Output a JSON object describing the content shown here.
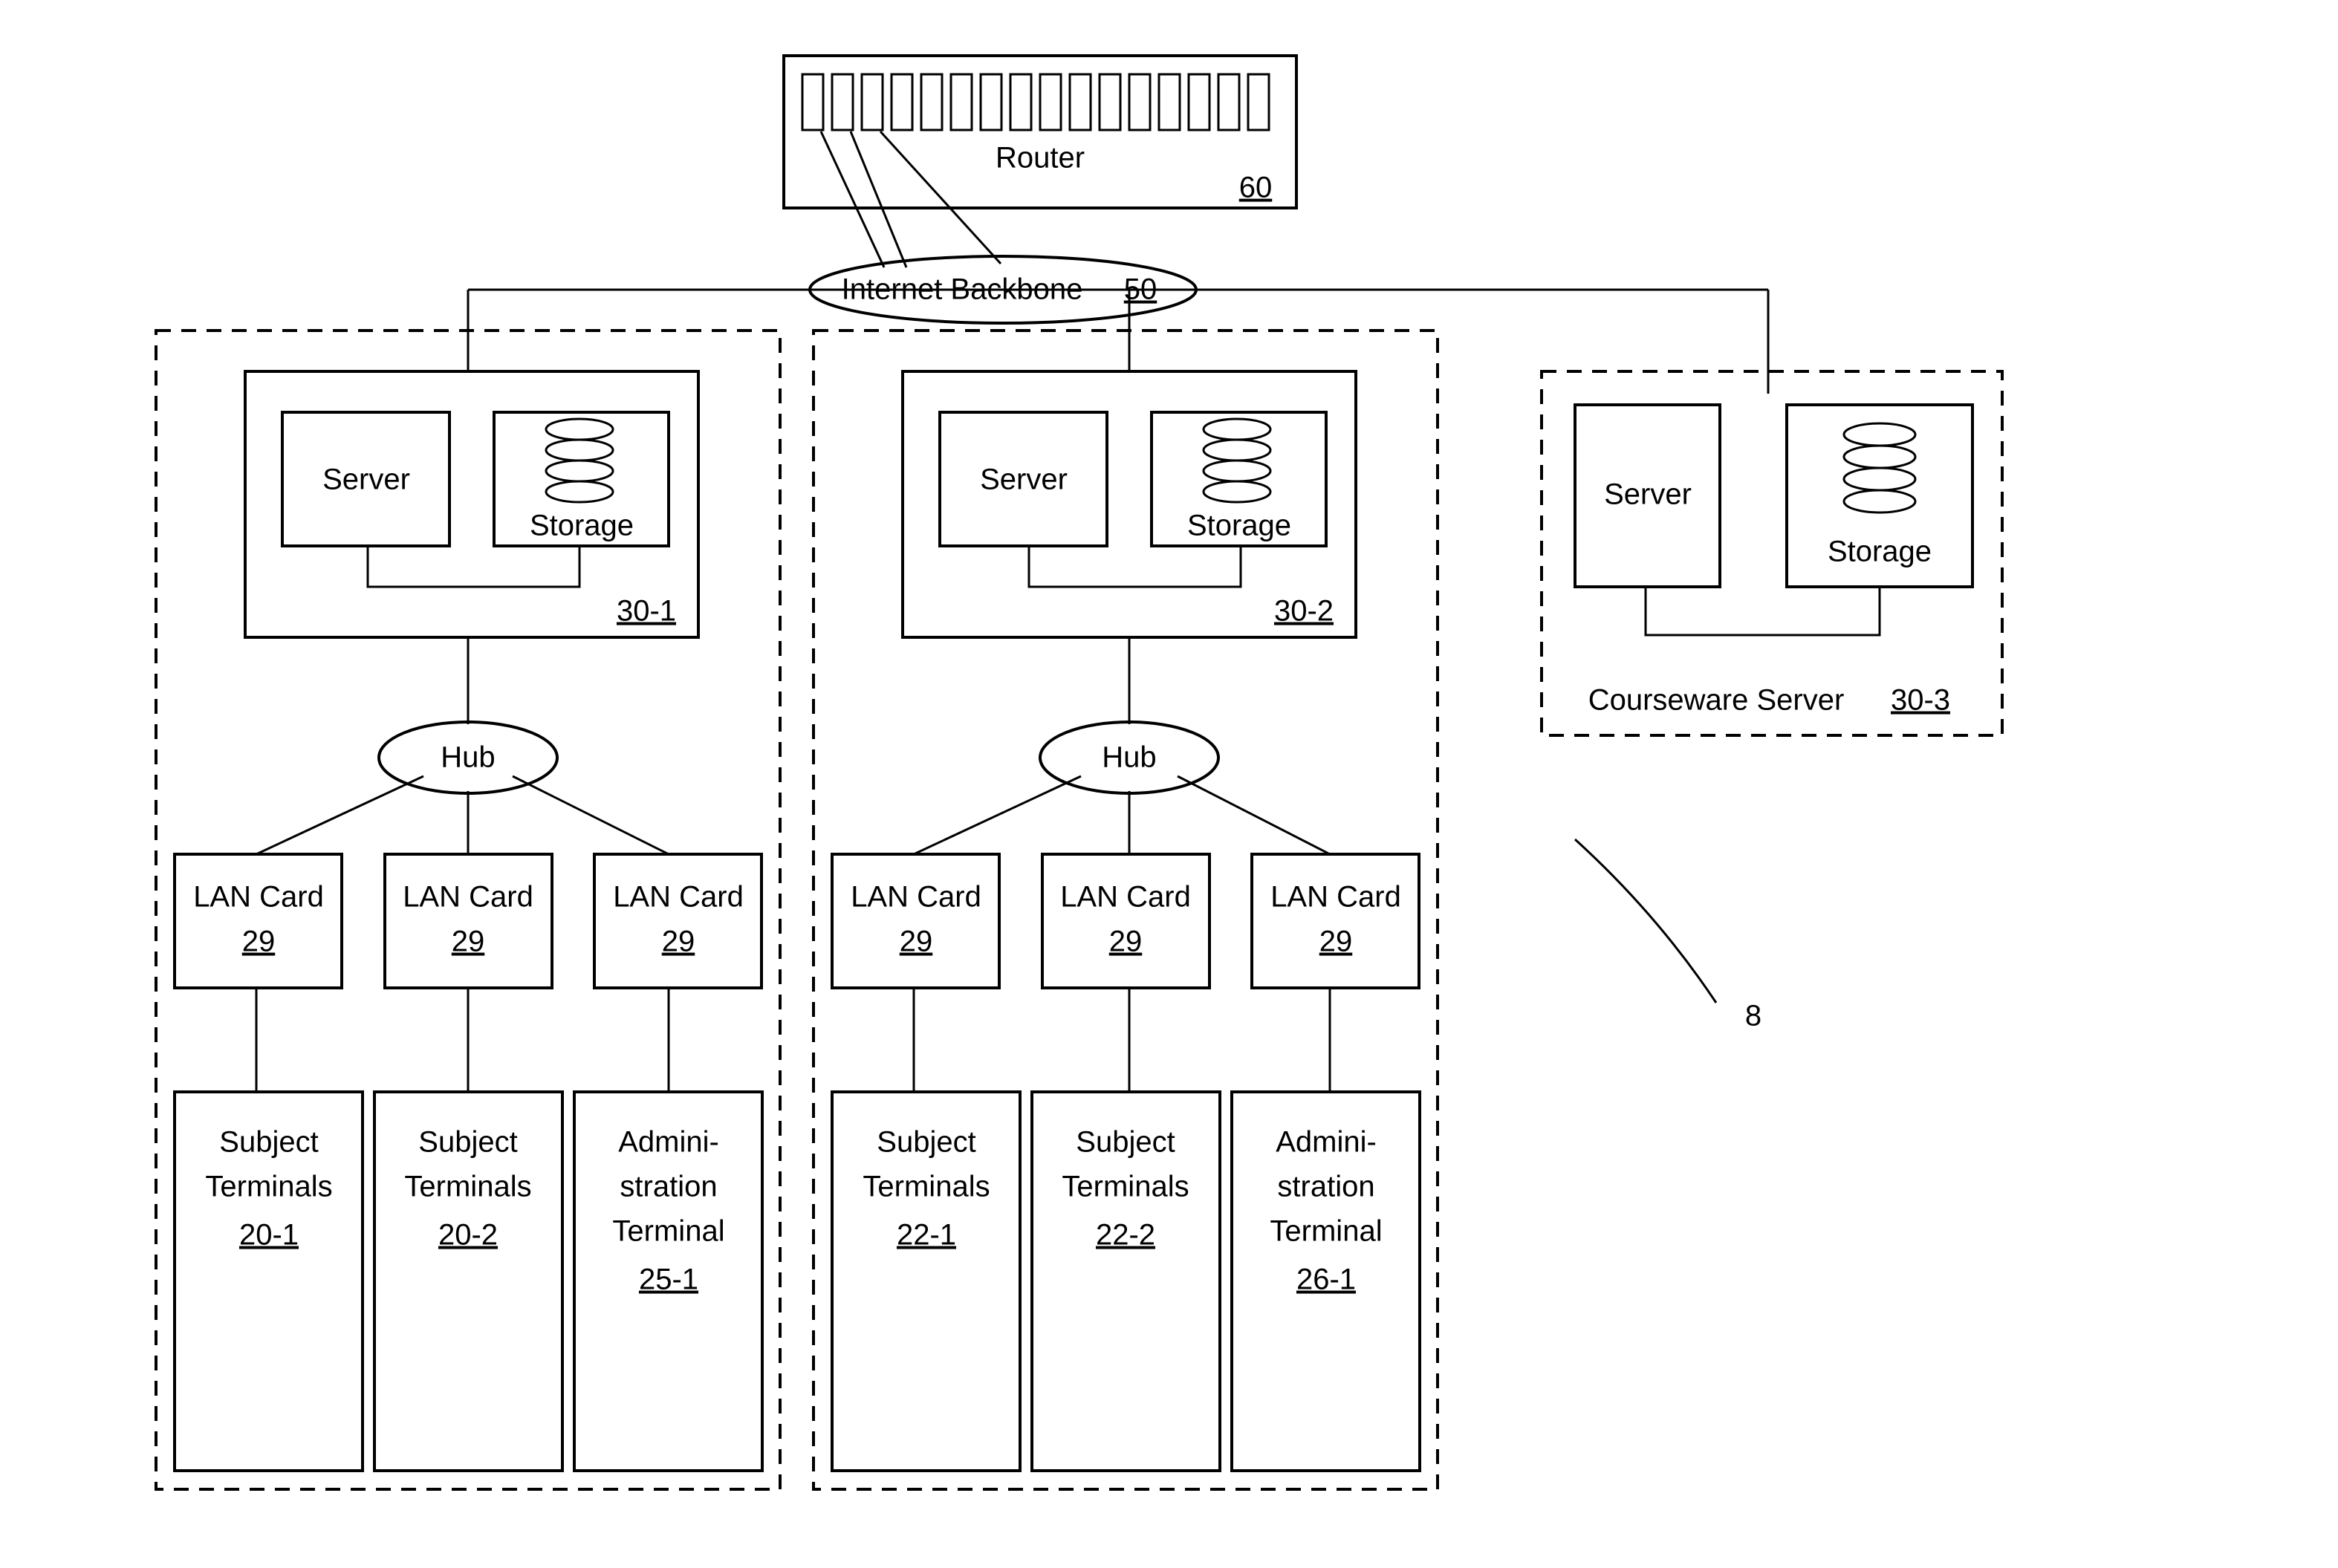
{
  "chart_data": {
    "type": "network-diagram",
    "nodes": [
      {
        "id": "router",
        "label": "Router",
        "ref": "60"
      },
      {
        "id": "backbone",
        "label": "Internet Backbone",
        "ref": "50"
      },
      {
        "id": "cluster1",
        "ref": "30-1",
        "server": "Server",
        "storage": "Storage",
        "hub": "Hub",
        "lancards": [
          "29",
          "29",
          "29"
        ],
        "terminals": [
          {
            "label": "Subject Terminals",
            "ref": "20-1"
          },
          {
            "label": "Subject Terminals",
            "ref": "20-2"
          },
          {
            "label": "Administration Terminal",
            "ref": "25-1"
          }
        ]
      },
      {
        "id": "cluster2",
        "ref": "30-2",
        "server": "Server",
        "storage": "Storage",
        "hub": "Hub",
        "lancards": [
          "29",
          "29",
          "29"
        ],
        "terminals": [
          {
            "label": "Subject Terminals",
            "ref": "22-1"
          },
          {
            "label": "Subject Terminals",
            "ref": "22-2"
          },
          {
            "label": "Administration Terminal",
            "ref": "26-1"
          }
        ]
      },
      {
        "id": "cluster3",
        "label": "Courseware Server",
        "ref": "30-3",
        "server": "Server",
        "storage": "Storage"
      },
      {
        "id": "figref",
        "ref": "8"
      }
    ],
    "edges": [
      [
        "backbone",
        "router"
      ],
      [
        "backbone",
        "cluster1"
      ],
      [
        "backbone",
        "cluster2"
      ],
      [
        "backbone",
        "cluster3"
      ],
      [
        "cluster1.server",
        "cluster1.hub"
      ],
      [
        "cluster2.server",
        "cluster2.hub"
      ],
      [
        "cluster1.hub",
        "cluster1.lan1"
      ],
      [
        "cluster1.hub",
        "cluster1.lan2"
      ],
      [
        "cluster1.hub",
        "cluster1.lan3"
      ],
      [
        "cluster2.hub",
        "cluster2.lan1"
      ],
      [
        "cluster2.hub",
        "cluster2.lan2"
      ],
      [
        "cluster2.hub",
        "cluster2.lan3"
      ],
      [
        "cluster1.lan1",
        "cluster1.term1"
      ],
      [
        "cluster1.lan2",
        "cluster1.term2"
      ],
      [
        "cluster1.lan3",
        "cluster1.term3"
      ],
      [
        "cluster2.lan1",
        "cluster2.term1"
      ],
      [
        "cluster2.lan2",
        "cluster2.term2"
      ],
      [
        "cluster2.lan3",
        "cluster2.term3"
      ]
    ]
  },
  "router": {
    "label": "Router",
    "ref": "60"
  },
  "backbone": {
    "label": "Internet Backbone",
    "ref": "50"
  },
  "server": "Server",
  "storage": "Storage",
  "hub": "Hub",
  "lancard": {
    "label": "LAN Card",
    "ref": "29"
  },
  "c1": {
    "ref": "30-1",
    "t1": {
      "l1": "Subject",
      "l2": "Terminals",
      "ref": "20-1"
    },
    "t2": {
      "l1": "Subject",
      "l2": "Terminals",
      "ref": "20-2"
    },
    "t3": {
      "l1": "Admini-",
      "l2": "stration",
      "l3": "Terminal",
      "ref": "25-1"
    }
  },
  "c2": {
    "ref": "30-2",
    "t1": {
      "l1": "Subject",
      "l2": "Terminals",
      "ref": "22-1"
    },
    "t2": {
      "l1": "Subject",
      "l2": "Terminals",
      "ref": "22-2"
    },
    "t3": {
      "l1": "Admini-",
      "l2": "stration",
      "l3": "Terminal",
      "ref": "26-1"
    }
  },
  "c3": {
    "label": "Courseware Server",
    "ref": "30-3"
  },
  "figref": "8"
}
